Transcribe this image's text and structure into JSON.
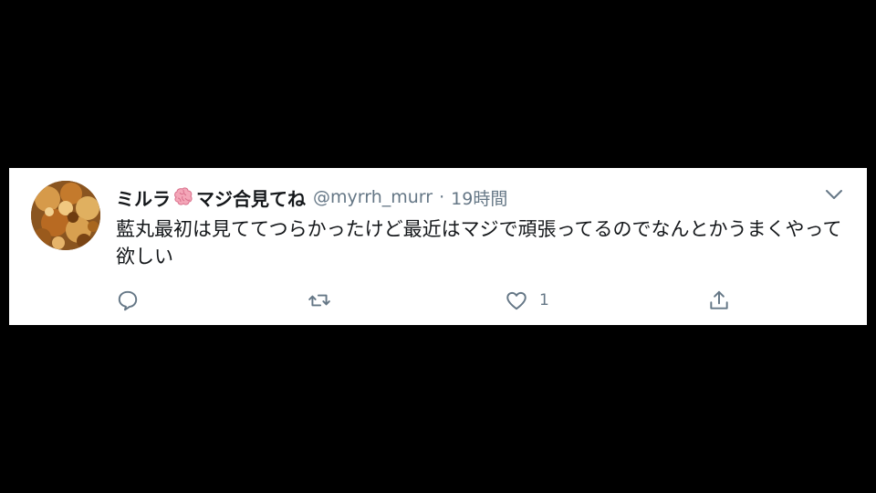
{
  "tweet": {
    "display_name": "ミルラ",
    "display_name_icon": "brain-emoji",
    "display_name_suffix": "マジ合見てね",
    "handle": "@myrrh_murr",
    "separator": "·",
    "timestamp": "19時間",
    "text": "藍丸最初は見ててつらかったけど最近はマジで頑張ってるのでなんとかうまくやって欲しい",
    "actions": {
      "reply": {
        "icon": "reply-icon",
        "count": ""
      },
      "retweet": {
        "icon": "retweet-icon",
        "count": ""
      },
      "like": {
        "icon": "heart-icon",
        "count": "1"
      },
      "share": {
        "icon": "share-icon",
        "count": ""
      }
    }
  },
  "colors": {
    "background": "#000000",
    "card": "#ffffff",
    "text_primary": "#14171a",
    "text_secondary": "#657786",
    "icon": "#657786"
  }
}
